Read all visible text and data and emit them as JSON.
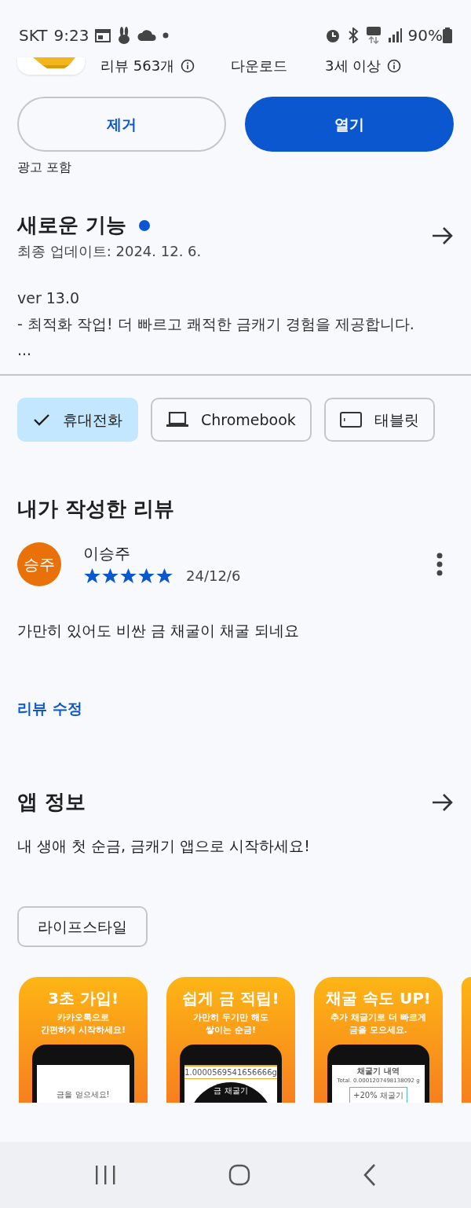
{
  "status_bar": {
    "carrier": "SKT",
    "time": "9:23",
    "battery": "90%"
  },
  "app_header": {
    "reviews": "리뷰 563개",
    "downloads": "다운로드",
    "age": "3세 이상"
  },
  "buttons": [
    {
      "label": "제거",
      "kind": "outline"
    },
    {
      "label": "열기",
      "kind": "filled"
    }
  ],
  "ads_note": "광고 포함",
  "whats_new": {
    "title": "새로운 기능",
    "new": true,
    "updated": "최종 업데이트: 2024. 12. 6.",
    "lines": [
      "ver 13.0",
      "- 최적화 작업! 더 빠르고 쾌적한 금캐기 경험을 제공합니다.",
      "..."
    ]
  },
  "devices": [
    {
      "label": "휴대전화",
      "selected": true
    },
    {
      "label": "Chromebook",
      "kind": "laptop",
      "selected": false
    },
    {
      "label": "태블릿",
      "kind": "tablet",
      "selected": false
    }
  ],
  "my_review": {
    "title": "내가 작성한 리뷰",
    "avatar": "승주",
    "author": "이승주",
    "stars": 5,
    "date": "24/12/6",
    "text": "가만히 있어도 비싼 금 채굴이 채굴 되네요",
    "edit_link": "리뷰 수정"
  },
  "app_info": {
    "title": "앱 정보",
    "description": "내 생애 첫 순금, 금캐기 앱으로 시작하세요!",
    "category": "라이프스타일"
  },
  "screenshots": [
    {
      "headline": "3초 가입!",
      "subtitle": [
        "카카오톡으로",
        "간편하게 시작하세요!"
      ],
      "kind": "login",
      "screen_texts": [
        "금을 얻으세요!"
      ]
    },
    {
      "headline": "쉽게 금 적립!",
      "subtitle": [
        "가만히 두기만 해도",
        "쌓이는 순금!"
      ],
      "kind": "miner",
      "screen_texts": [
        "1.0000569541656666g",
        "금 채굴기"
      ]
    },
    {
      "headline": "채굴 속도 UP!",
      "subtitle": [
        "추가 채굴기로 더 빠르게",
        "금을 모으세요."
      ],
      "kind": "list",
      "screen_texts": [
        "채굴기 내역",
        "Total. 0.0001207498138092 g",
        "+20% 채굴기"
      ]
    },
    {
      "kind": "partial"
    }
  ]
}
